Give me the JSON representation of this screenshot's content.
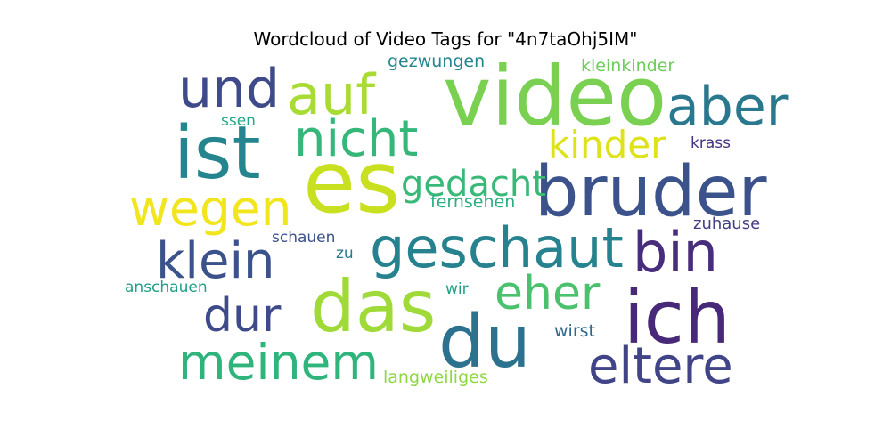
{
  "chart_data": {
    "type": "wordcloud",
    "title": "Wordcloud of Video Tags for \"4n7taOhj5IM\"",
    "words": [
      {
        "text": "video",
        "weight": 1.0,
        "color": "#7ad151"
      },
      {
        "text": "es",
        "weight": 1.0,
        "color": "#c8e020"
      },
      {
        "text": "ist",
        "weight": 0.95,
        "color": "#25858e"
      },
      {
        "text": "bruder",
        "weight": 0.85,
        "color": "#3b528b"
      },
      {
        "text": "ich",
        "weight": 0.9,
        "color": "#482878"
      },
      {
        "text": "das",
        "weight": 0.88,
        "color": "#a0da39"
      },
      {
        "text": "du",
        "weight": 0.88,
        "color": "#2c728e"
      },
      {
        "text": "und",
        "weight": 0.68,
        "color": "#3e4a89"
      },
      {
        "text": "auf",
        "weight": 0.68,
        "color": "#a8db34"
      },
      {
        "text": "aber",
        "weight": 0.65,
        "color": "#2a788e"
      },
      {
        "text": "nicht",
        "weight": 0.65,
        "color": "#35b779"
      },
      {
        "text": "geschaut",
        "weight": 0.72,
        "color": "#26828e"
      },
      {
        "text": "bin",
        "weight": 0.68,
        "color": "#472d7b"
      },
      {
        "text": "klein",
        "weight": 0.62,
        "color": "#3b528b"
      },
      {
        "text": "wegen",
        "weight": 0.62,
        "color": "#f1e51d"
      },
      {
        "text": "eltere",
        "weight": 0.62,
        "color": "#414487"
      },
      {
        "text": "meinem",
        "weight": 0.62,
        "color": "#2fb47c"
      },
      {
        "text": "eher",
        "weight": 0.58,
        "color": "#4ac16d"
      },
      {
        "text": "dur",
        "weight": 0.58,
        "color": "#3e4a89"
      },
      {
        "text": "kinder",
        "weight": 0.5,
        "color": "#dde318"
      },
      {
        "text": "gedacht",
        "weight": 0.48,
        "color": "#38b977"
      },
      {
        "text": "gezwungen",
        "weight": 0.25,
        "color": "#25858e"
      },
      {
        "text": "kleinkinder",
        "weight": 0.25,
        "color": "#6ccd5a"
      },
      {
        "text": "krass",
        "weight": 0.22,
        "color": "#46327e"
      },
      {
        "text": "ssen",
        "weight": 0.22,
        "color": "#22a884"
      },
      {
        "text": "fernsehen",
        "weight": 0.24,
        "color": "#2ab07f"
      },
      {
        "text": "zuhause",
        "weight": 0.24,
        "color": "#433e85"
      },
      {
        "text": "schauen",
        "weight": 0.23,
        "color": "#3b528b"
      },
      {
        "text": "zu",
        "weight": 0.2,
        "color": "#2a788e"
      },
      {
        "text": "anschauen",
        "weight": 0.23,
        "color": "#1f9e89"
      },
      {
        "text": "wir",
        "weight": 0.2,
        "color": "#1fa188"
      },
      {
        "text": "wirst",
        "weight": 0.24,
        "color": "#31688e"
      },
      {
        "text": "langweiliges",
        "weight": 0.24,
        "color": "#90d743"
      }
    ]
  }
}
